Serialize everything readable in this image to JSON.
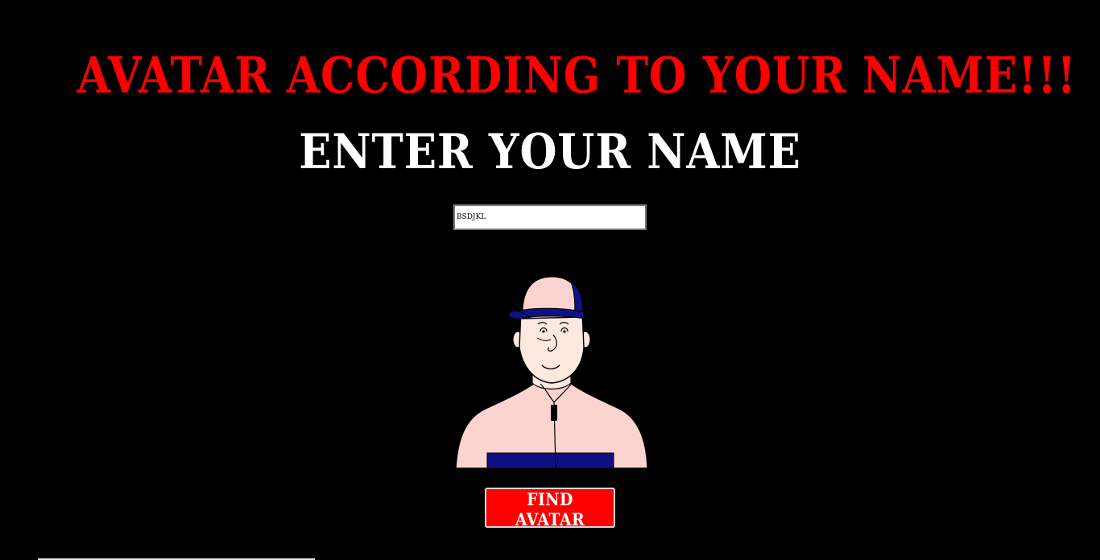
{
  "page": {
    "title": "AVATAR ACCORDING TO YOUR NAME!!!",
    "subtitle": "ENTER YOUR NAME"
  },
  "name_input": {
    "value": "BSDJKL"
  },
  "avatar": {
    "icon": "cartoon-person-with-cap-avatar"
  },
  "find_button": {
    "label": "FIND AVATAR"
  },
  "colors": {
    "background": "#000000",
    "title": "#ff0000",
    "subtitle": "#ffffff",
    "button": "#ff0000",
    "skin": "#fce8df",
    "jacket": "#fbd4cf",
    "cap_blue": "#101084"
  }
}
